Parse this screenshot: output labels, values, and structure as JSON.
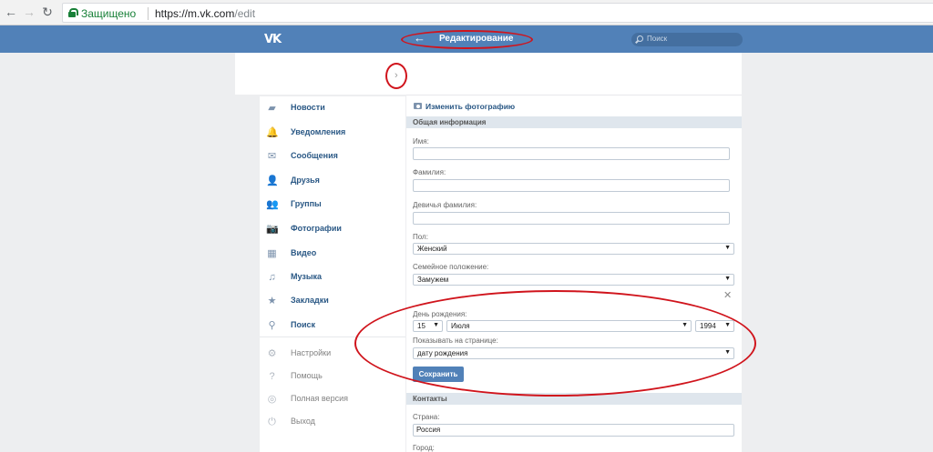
{
  "browser": {
    "secure_label": "Защищено",
    "url_scheme_host": "https://m.vk.com",
    "url_path": "/edit"
  },
  "header": {
    "logo": "VK",
    "title": "Редактирование",
    "search_placeholder": "Поиск"
  },
  "sidebar": {
    "items": [
      {
        "label": "Новости",
        "icon": "news-icon",
        "glyph": "▰"
      },
      {
        "label": "Уведомления",
        "icon": "bell-icon",
        "glyph": "🔔"
      },
      {
        "label": "Сообщения",
        "icon": "envelope-icon",
        "glyph": "✉"
      },
      {
        "label": "Друзья",
        "icon": "person-icon",
        "glyph": "👤"
      },
      {
        "label": "Группы",
        "icon": "people-icon",
        "glyph": "👥"
      },
      {
        "label": "Фотографии",
        "icon": "camera-icon",
        "glyph": "📷"
      },
      {
        "label": "Видео",
        "icon": "film-icon",
        "glyph": "▦"
      },
      {
        "label": "Музыка",
        "icon": "music-icon",
        "glyph": "♫"
      },
      {
        "label": "Закладки",
        "icon": "star-icon",
        "glyph": "★"
      },
      {
        "label": "Поиск",
        "icon": "magnifier-icon",
        "glyph": "⚲"
      },
      {
        "label": "Настройки",
        "icon": "gear-icon",
        "glyph": "⚙"
      },
      {
        "label": "Помощь",
        "icon": "help-icon",
        "glyph": "?"
      },
      {
        "label": "Полная версия",
        "icon": "globe-icon",
        "glyph": "◎"
      },
      {
        "label": "Выход",
        "icon": "power-icon",
        "glyph": "⏻"
      }
    ]
  },
  "main": {
    "change_photo": "Изменить фотографию",
    "general_section": "Общая информация",
    "first_name_label": "Имя:",
    "first_name_value": "",
    "last_name_label": "Фамилия:",
    "last_name_value": "",
    "maiden_name_label": "Девичья фамилия:",
    "maiden_name_value": "",
    "gender_label": "Пол:",
    "gender_value": "Женский",
    "marital_label": "Семейное положение:",
    "marital_value": "Замужем",
    "birthday_label": "День рождения:",
    "birth_day": "15",
    "birth_month": "Июля",
    "birth_year": "1994",
    "show_label": "Показывать на странице:",
    "show_value": "дату рождения",
    "save_button": "Сохранить",
    "contacts_section": "Контакты",
    "country_label": "Страна:",
    "country_value": "Россия",
    "city_label": "Город:"
  },
  "colors": {
    "vk_blue": "#5181b8",
    "annotation_red": "#d0141c",
    "link_blue": "#2a5885"
  }
}
